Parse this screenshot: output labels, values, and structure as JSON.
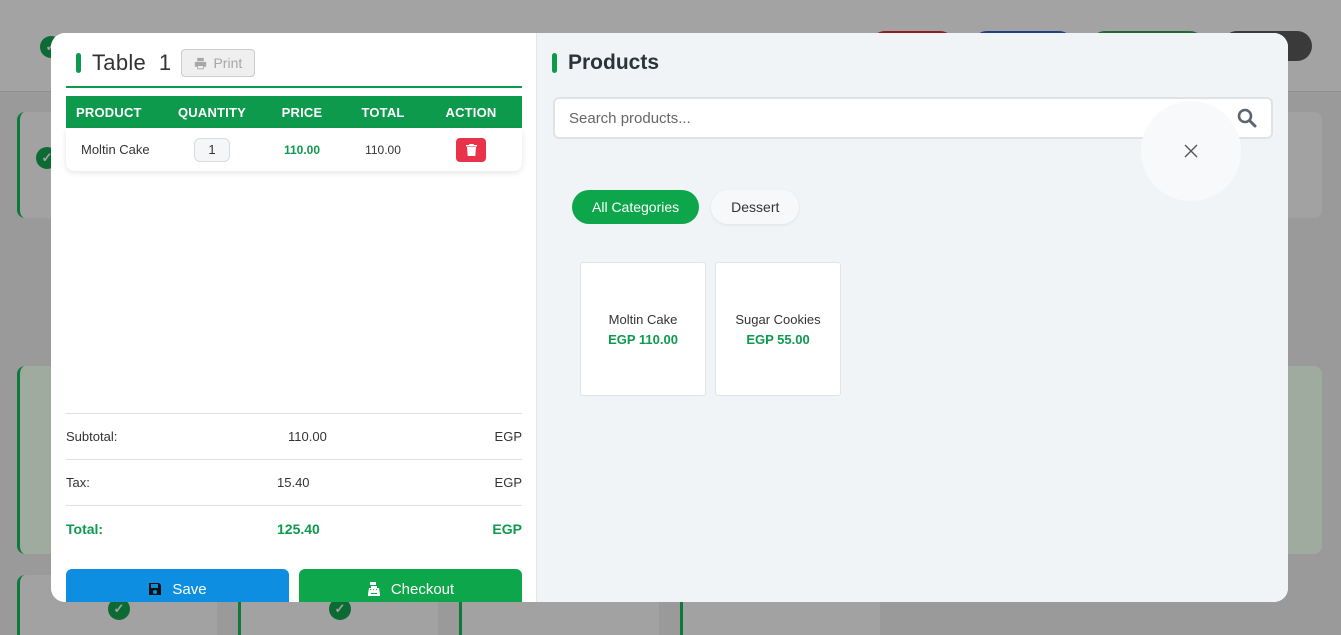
{
  "order": {
    "table_label": "Table  1",
    "print_label": "Print",
    "columns": [
      "PRODUCT",
      "QUANTITY",
      "PRICE",
      "TOTAL",
      "ACTION"
    ],
    "items": [
      {
        "product": "Moltin Cake",
        "quantity": "1",
        "price": "110.00",
        "total": "110.00"
      }
    ],
    "summary": {
      "subtotal_label": "Subtotal:",
      "subtotal_value": "110.00",
      "subtotal_currency": "EGP",
      "tax_label": "Tax:",
      "tax_value": "15.40",
      "tax_currency": "EGP",
      "total_label": "Total:",
      "total_value": "125.40",
      "total_currency": "EGP"
    },
    "save_label": "Save",
    "checkout_label": "Checkout"
  },
  "products_panel": {
    "title": "Products",
    "search_placeholder": "Search products...",
    "categories": [
      {
        "label": "All Categories",
        "active": true
      },
      {
        "label": "Dessert",
        "active": false
      }
    ],
    "products": [
      {
        "name": "Moltin Cake",
        "price": "EGP 110.00"
      },
      {
        "name": "Sugar Cookies",
        "price": "EGP 55.00"
      }
    ]
  },
  "colors": {
    "accent_green": "#0e9a4d",
    "checkout_green": "#0ea64a",
    "save_blue": "#0d8ee0",
    "delete_red": "#e8334a"
  },
  "icons": {
    "print": "printer-icon",
    "delete": "trash-icon",
    "save": "floppy-disk-icon",
    "checkout": "cash-register-icon",
    "search": "search-icon",
    "close": "close-icon"
  }
}
